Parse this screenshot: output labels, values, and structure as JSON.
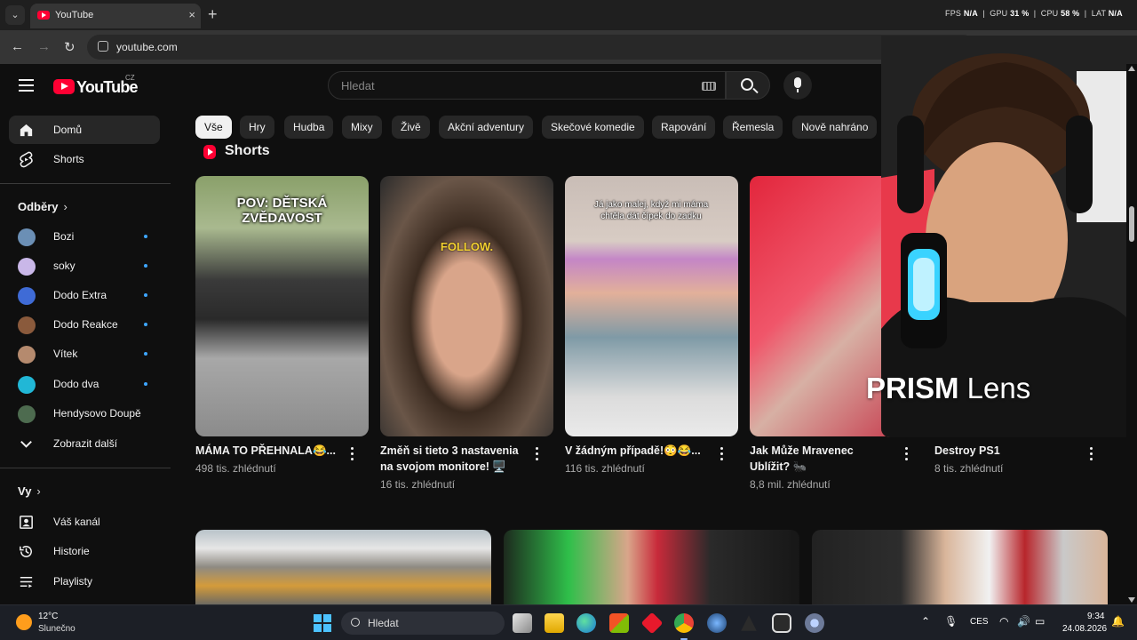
{
  "browser": {
    "tab_title": "YouTube",
    "tab_close": "×",
    "new_tab": "+",
    "url": "youtube.com",
    "stats": {
      "fps_label": "FPS",
      "fps_value": "N/A",
      "gpu_label": "GPU",
      "gpu_value": "31 %",
      "cpu_label": "CPU",
      "cpu_value": "58 %",
      "lat_label": "LAT",
      "lat_value": "N/A"
    }
  },
  "header": {
    "logo_text": "YouTube",
    "country": "CZ",
    "search_placeholder": "Hledat"
  },
  "sidebar": {
    "main": [
      {
        "label": "Domů",
        "icon": "home-icon"
      },
      {
        "label": "Shorts",
        "icon": "shorts-icon"
      }
    ],
    "subscriptions_title": "Odběry",
    "subscriptions": [
      {
        "label": "Bozi",
        "color": "#6b8fb5"
      },
      {
        "label": "soky",
        "color": "#c9b7e8"
      },
      {
        "label": "Dodo Extra",
        "color": "#3f6bd6"
      },
      {
        "label": "Dodo Reakce",
        "color": "#8a5a3c"
      },
      {
        "label": "Vítek",
        "color": "#b58a6e"
      },
      {
        "label": "Dodo dva",
        "color": "#21b7d6"
      },
      {
        "label": "Hendysovo Doupě",
        "color": "#4d6b4f"
      }
    ],
    "show_more": "Zobrazit další",
    "you_title": "Vy",
    "you_items": [
      {
        "label": "Váš kanál",
        "icon": "user-icon"
      },
      {
        "label": "Historie",
        "icon": "history-icon"
      },
      {
        "label": "Playlisty",
        "icon": "playlist-icon"
      }
    ]
  },
  "chips": [
    "Vše",
    "Hry",
    "Hudba",
    "Mixy",
    "Živě",
    "Akční adventury",
    "Skečové komedie",
    "Rapování",
    "Řemesla",
    "Nově nahráno"
  ],
  "shorts": {
    "title": "Shorts",
    "items": [
      {
        "title": "MÁMA TO PŘEHNALA😂...",
        "views": "498 tis. zhlédnutí",
        "caption": "POV: DĚTSKÁ ZVĚDAVOST"
      },
      {
        "title": "Změň si tieto 3 nastavenia na svojom monitore! 🖥️",
        "views": "16 tis. zhlédnutí",
        "caption": "FOLLOW."
      },
      {
        "title": "V žádným případě!😳😂...",
        "views": "116 tis. zhlédnutí",
        "caption": "Já jako malej, když mi máma chtěla dát čípek do zadku"
      },
      {
        "title": "Jak Může Mravenec Ublížit? 🐜",
        "views": "8,8 mil. zhlédnutí",
        "caption": ""
      },
      {
        "title": "Destroy PS1",
        "views": "8 tis. zhlédnutí",
        "caption": ""
      }
    ]
  },
  "webcam_overlay": {
    "brand_bold": "PRISM",
    "brand_light": " Lens"
  },
  "taskbar": {
    "weather_temp": "12°C",
    "weather_condition": "Slunečno",
    "search_placeholder": "Hledat",
    "language": "CES",
    "time": "9:34",
    "date": "24.08.2026"
  }
}
